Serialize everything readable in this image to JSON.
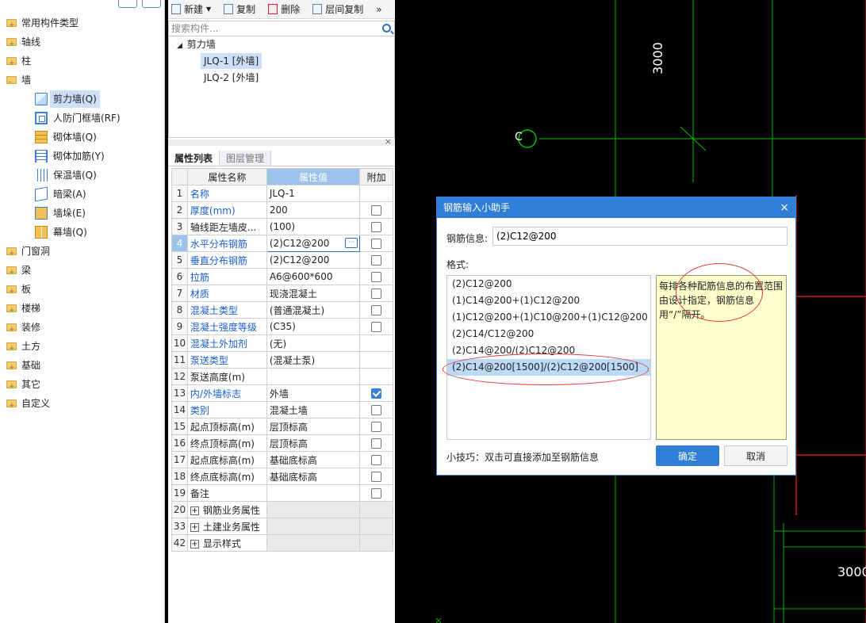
{
  "left_tree": {
    "items": [
      {
        "label": "常用构件类型",
        "level": 0,
        "open": false
      },
      {
        "label": "轴线",
        "level": 0,
        "open": false
      },
      {
        "label": "柱",
        "level": 0,
        "open": false
      },
      {
        "label": "墙",
        "level": 0,
        "open": true
      },
      {
        "label": "剪力墙(Q)",
        "level": 1,
        "icon": "shear-wall-icon",
        "selected": true
      },
      {
        "label": "人防门框墙(RF)",
        "level": 1,
        "icon": "civil-defense-door-frame-icon"
      },
      {
        "label": "砌体墙(Q)",
        "level": 1,
        "icon": "masonry-wall-icon"
      },
      {
        "label": "砌体加筋(Y)",
        "level": 1,
        "icon": "masonry-rebar-icon"
      },
      {
        "label": "保温墙(Q)",
        "level": 1,
        "icon": "insulation-wall-icon"
      },
      {
        "label": "暗梁(A)",
        "level": 1,
        "icon": "hidden-beam-icon"
      },
      {
        "label": "墙垛(E)",
        "level": 1,
        "icon": "wall-pier-icon"
      },
      {
        "label": "幕墙(Q)",
        "level": 1,
        "icon": "curtain-wall-icon"
      },
      {
        "label": "门窗洞",
        "level": 0,
        "open": false
      },
      {
        "label": "梁",
        "level": 0,
        "open": false
      },
      {
        "label": "板",
        "level": 0,
        "open": false
      },
      {
        "label": "楼梯",
        "level": 0,
        "open": false
      },
      {
        "label": "装修",
        "level": 0,
        "open": false
      },
      {
        "label": "土方",
        "level": 0,
        "open": false
      },
      {
        "label": "基础",
        "level": 0,
        "open": false
      },
      {
        "label": "其它",
        "level": 0,
        "open": false
      },
      {
        "label": "自定义",
        "level": 0,
        "open": false
      }
    ]
  },
  "toolbar": {
    "new_label": "新建",
    "copy_label": "复制",
    "delete_label": "删除",
    "layer_copy_label": "层间复制",
    "more": "»"
  },
  "search": {
    "placeholder": "搜索构件..."
  },
  "component_tree": {
    "group": "剪力墙",
    "items": [
      "JLQ-1 [外墙]",
      "JLQ-2 [外墙]"
    ]
  },
  "prop_tabs": [
    "属性列表",
    "图层管理"
  ],
  "prop_table": {
    "headers": [
      "属性名称",
      "属性值",
      "附加"
    ],
    "rows": [
      {
        "num": "1",
        "name": "名称",
        "value": "JLQ-1",
        "blue": true,
        "checkbox": "none"
      },
      {
        "num": "2",
        "name": "厚度(mm)",
        "value": "200",
        "blue": true,
        "checkbox": "off"
      },
      {
        "num": "3",
        "name": "轴线距左墙皮...",
        "value": "(100)",
        "blue": false,
        "checkbox": "off"
      },
      {
        "num": "4",
        "name": "水平分布钢筋",
        "value": "(2)C12@200",
        "blue": true,
        "checkbox": "off",
        "active": true
      },
      {
        "num": "5",
        "name": "垂直分布钢筋",
        "value": "(2)C12@200",
        "blue": true,
        "checkbox": "off"
      },
      {
        "num": "6",
        "name": "拉筋",
        "value": "A6@600*600",
        "blue": true,
        "checkbox": "off"
      },
      {
        "num": "7",
        "name": "材质",
        "value": "现浇混凝土",
        "blue": true,
        "checkbox": "off"
      },
      {
        "num": "8",
        "name": "混凝土类型",
        "value": "(普通混凝土)",
        "blue": true,
        "checkbox": "off"
      },
      {
        "num": "9",
        "name": "混凝土强度等级",
        "value": "(C35)",
        "blue": true,
        "checkbox": "off"
      },
      {
        "num": "10",
        "name": "混凝土外加剂",
        "value": "(无)",
        "blue": true,
        "checkbox": "none"
      },
      {
        "num": "11",
        "name": "泵送类型",
        "value": "(混凝土泵)",
        "blue": true,
        "checkbox": "none"
      },
      {
        "num": "12",
        "name": "泵送高度(m)",
        "value": "",
        "blue": false,
        "checkbox": "none"
      },
      {
        "num": "13",
        "name": "内/外墙标志",
        "value": "外墙",
        "blue": true,
        "checkbox": "on"
      },
      {
        "num": "14",
        "name": "类别",
        "value": "混凝土墙",
        "blue": true,
        "checkbox": "off"
      },
      {
        "num": "15",
        "name": "起点顶标高(m)",
        "value": "层顶标高",
        "blue": false,
        "checkbox": "off"
      },
      {
        "num": "16",
        "name": "终点顶标高(m)",
        "value": "层顶标高",
        "blue": false,
        "checkbox": "off"
      },
      {
        "num": "17",
        "name": "起点底标高(m)",
        "value": "基础底标高",
        "blue": false,
        "checkbox": "off"
      },
      {
        "num": "18",
        "name": "终点底标高(m)",
        "value": "基础底标高",
        "blue": false,
        "checkbox": "off"
      },
      {
        "num": "19",
        "name": "备注",
        "value": "",
        "blue": false,
        "checkbox": "off"
      },
      {
        "num": "20",
        "name": "钢筋业务属性",
        "value": "",
        "group": true,
        "checkbox": "none"
      },
      {
        "num": "33",
        "name": "土建业务属性",
        "value": "",
        "group": true,
        "checkbox": "none"
      },
      {
        "num": "42",
        "name": "显示样式",
        "value": "",
        "group": true,
        "checkbox": "none"
      }
    ]
  },
  "cad": {
    "axis_label": "C",
    "dim_top": "3000",
    "dim_right": "3000",
    "line_colors": {
      "axis": "#00c000",
      "wall": "#ff2020",
      "wall_green": "#00b000"
    }
  },
  "dialog": {
    "title": "钢筋输入小助手",
    "close": "×",
    "info_label": "钢筋信息:",
    "info_value": "(2)C12@200",
    "format_label": "格式:",
    "formats": [
      "(2)C12@200",
      "(1)C14@200+(1)C12@200",
      "(1)C12@200+(1)C10@200+(1)C12@200",
      "(2)C14/C12@200",
      "(2)C14@200/(2)C12@200",
      "(2)C14@200[1500]/(2)C12@200[1500]"
    ],
    "selected_format_index": 5,
    "hint": "每排各种配筋信息的布置范围由设计指定，钢筋信息用“/”隔开。",
    "tip": "小技巧：双击可直接添加至钢筋信息",
    "ok_label": "确定",
    "cancel_label": "取消"
  }
}
